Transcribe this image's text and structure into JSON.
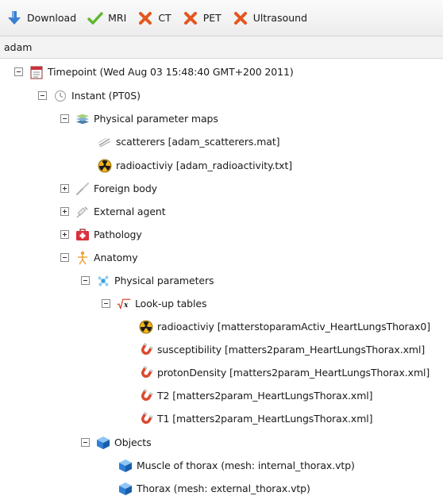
{
  "toolbar": {
    "download": "Download",
    "mri": "MRI",
    "ct": "CT",
    "pet": "PET",
    "ultrasound": "Ultrasound"
  },
  "subject": "adam",
  "tree": {
    "timepoint": "Timepoint (Wed Aug 03 15:48:40 GMT+200 2011)",
    "instant": "Instant (PT0S)",
    "physical_parameter_maps": "Physical parameter maps",
    "scatterers": "scatterers [adam_scatterers.mat]",
    "radioactivity_map": "radioactiviy [adam_radioactivity.txt]",
    "foreign_body": "Foreign body",
    "external_agent": "External agent",
    "pathology": "Pathology",
    "anatomy": "Anatomy",
    "physical_parameters": "Physical parameters",
    "lookup_tables": "Look-up tables",
    "lut_radioactivity": "radioactiviy [matterstoparamActiv_HeartLungsThorax0]",
    "lut_susceptibility": "susceptibility [matters2param_HeartLungsThorax.xml]",
    "lut_proton_density": "protonDensity [matters2param_HeartLungsThorax.xml]",
    "lut_t2": "T2 [matters2param_HeartLungsThorax.xml]",
    "lut_t1": "T1 [matters2param_HeartLungsThorax.xml]",
    "objects": "Objects",
    "muscle_of_thorax": "Muscle of thorax (mesh: internal_thorax.vtp)",
    "thorax": "Thorax (mesh: external_thorax.vtp)"
  },
  "colors": {
    "download": "#3a7fd0",
    "check": "#5cb82e",
    "cross": "#e2571e",
    "radioactive": "#f2b21a",
    "magnet": "#d9492e",
    "cube": "#2f7fd6",
    "anatomy": "#f0a030",
    "pathology": "#d8323c"
  }
}
